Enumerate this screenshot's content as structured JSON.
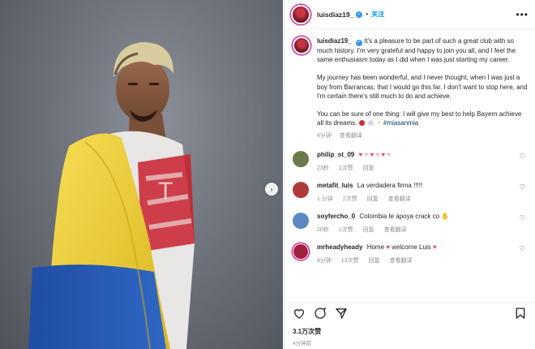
{
  "post": {
    "username": "luisdiaz19_",
    "follow_label": "关注",
    "more_label": "•••"
  },
  "caption": {
    "username": "luisdiaz19_",
    "p1": "It's a pleasure to be part of such a great club with so much history. I'm very grateful and happy to join you all, and I feel the same enthusiasm today as I did when I was just starting my career.",
    "p2": "My journey has been wonderful, and I never thought, when I was just a boy from Barrancas, that I would go this far. I don't want to stop here, and I'm certain there's still much to do and achieve.",
    "p3": "You can be sure of one thing: I will give my best to help Bayern achieve all its dreams.",
    "hashtag": "#miasanmia",
    "time": "4分钟",
    "translate": "查看翻译"
  },
  "comments": [
    {
      "username": "philip_st_09",
      "text": "",
      "emoji": [
        "heart-red",
        "heart-pink",
        "heart-red",
        "heart-pink",
        "heart-red",
        "heart-pink"
      ],
      "time": "23秒",
      "likes": "1次赞",
      "reply": "回复",
      "translate": "",
      "avatar_color": "#6b7a4a"
    },
    {
      "username": "metafit_luis",
      "text": "La verdadera firma !!!!!",
      "emoji": [],
      "time": "1 分钟",
      "likes": "2次赞",
      "reply": "回复",
      "translate": "查看翻译",
      "avatar_color": "#b03a3a"
    },
    {
      "username": "soyfercho_0",
      "text": "Colombia te apoya crack co",
      "emoji": [
        "clap"
      ],
      "time": "20秒",
      "likes": "1次赞",
      "reply": "回复",
      "translate": "查看翻译",
      "avatar_color": "#5a8ac0"
    },
    {
      "username": "mrheadyheady",
      "text": "Home",
      "text2": "welcome Luis",
      "emoji": [
        "heart-red"
      ],
      "time": "4分钟",
      "likes": "13次赞",
      "reply": "回复",
      "translate": "查看翻译",
      "avatar_color": "#a02040"
    }
  ],
  "footer": {
    "likes": "3.1万次赞",
    "time": "4分钟前"
  },
  "colors": {
    "accent": "#0095f6",
    "heart": "#ed4956",
    "yellow": "#f4d23c",
    "blue": "#2a5fb5",
    "red": "#c9202e"
  }
}
